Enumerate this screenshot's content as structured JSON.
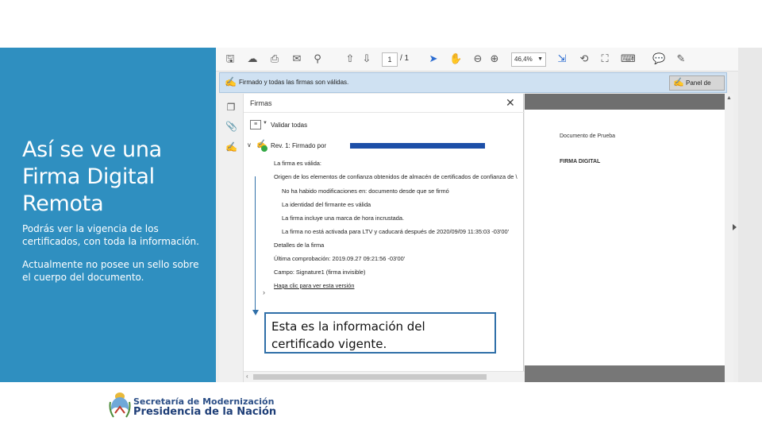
{
  "left_panel": {
    "title": "Así se ve una Firma Digital Remota",
    "paragraph1": "Podrás ver la vigencia de los certificados, con toda la información.",
    "paragraph2": "Actualmente no posee un sello sobre el cuerpo del documento."
  },
  "toolbar": {
    "page_current": "1",
    "page_total": "/ 1",
    "zoom": "46,4%"
  },
  "signature_bar": {
    "message": "Firmado y todas las firmas son válidas.",
    "panel_button": "Panel de firma"
  },
  "signatures_panel": {
    "title": "Firmas",
    "validate_all": "Validar todas",
    "signature_label": "Rev. 1: Firmado por",
    "lines": [
      "La firma es válida:",
      "Origen de los elementos de confianza obtenidos de almacén de certificados de confianza de \\",
      "No ha habido modificaciones en: documento desde que se firmó",
      "La identidad del firmante es válida",
      "La firma incluye una marca de hora incrustada.",
      "La firma no está activada para LTV y caducará después de 2020/09/09 11:35:03 -03'00'",
      "Detalles de la firma",
      "Última comprobación: 2019.09.27 09:21:56 -03'00'",
      "Campo: Signature1 (firma invisible)",
      "Haga clic para ver esta versión"
    ]
  },
  "document": {
    "title": "Documento de Prueba",
    "subtitle": "FIRMA DIGITAL"
  },
  "callout": {
    "text": "Esta es la información del certificado vigente."
  },
  "footer": {
    "line1": "Secretaría de Modernización",
    "line2": "Presidencia de la Nación"
  },
  "colors": {
    "left_panel_bg": "#2f8fc0",
    "callout_border": "#2f6fa8",
    "valid_check": "#33a845"
  }
}
